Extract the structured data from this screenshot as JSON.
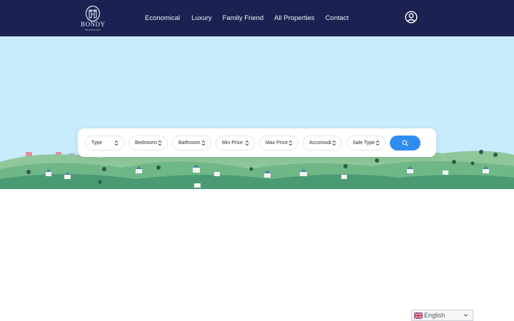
{
  "brand": {
    "logo_text": "BONDY",
    "logo_subtext": "PROPERTIES"
  },
  "nav": {
    "items": [
      {
        "label": "Economical"
      },
      {
        "label": "Luxury"
      },
      {
        "label": "Family Friend"
      },
      {
        "label": "All Properties"
      },
      {
        "label": "Contact"
      }
    ]
  },
  "search": {
    "filters": [
      {
        "label": "Type"
      },
      {
        "label": "Bedrooms"
      },
      {
        "label": "Bathrooms"
      },
      {
        "label": "Min Price"
      },
      {
        "label": "Max Price"
      },
      {
        "label": "Accomodation"
      },
      {
        "label": "Sale Type"
      }
    ],
    "button_icon": "search-icon"
  },
  "language": {
    "selected": "English",
    "flag_icon": "uk-flag-icon"
  },
  "colors": {
    "header_bg": "#1b2150",
    "sky": "#c8ecfb",
    "accent": "#2f8df1"
  }
}
